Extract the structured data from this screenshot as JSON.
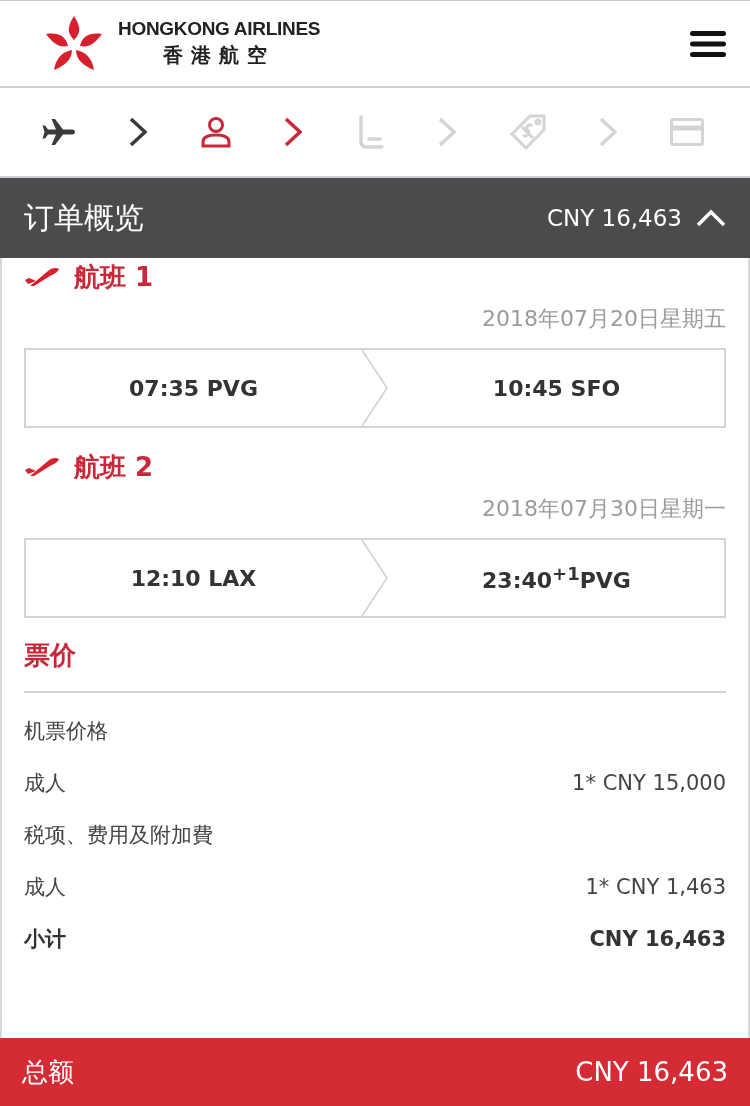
{
  "header": {
    "brand_en": "HONGKONG AIRLINES",
    "brand_zh": "香港航空"
  },
  "steps": [
    {
      "kind": "flight",
      "completed": true,
      "selected": false
    },
    {
      "kind": "passenger",
      "completed": false,
      "selected": true
    },
    {
      "kind": "seat",
      "completed": false,
      "selected": false
    },
    {
      "kind": "extras",
      "completed": false,
      "selected": false
    },
    {
      "kind": "payment",
      "completed": false,
      "selected": false
    }
  ],
  "summary": {
    "title": "订单概览",
    "amount": "CNY 16,463",
    "expanded": true
  },
  "flights": [
    {
      "title": "航班 1",
      "date": "2018年07月20日星期五",
      "depart": "07:35 PVG",
      "arrive": "10:45 SFO"
    },
    {
      "title": "航班 2",
      "date": "2018年07月30日星期一",
      "depart": "12:10 LAX",
      "arrive": "23:40$^{+1}$PVG"
    }
  ],
  "fare": {
    "title": "票价",
    "lines": [
      {
        "kind": "heading",
        "label": "机票价格"
      },
      {
        "kind": "item",
        "label": "成人",
        "amount": "1* CNY 15,000"
      },
      {
        "kind": "heading",
        "label": "税项、费用及附加費"
      },
      {
        "kind": "item",
        "label": "成人",
        "amount": "1* CNY 1,463"
      },
      {
        "kind": "subtotal",
        "label": "小计",
        "amount": "CNY 16,463"
      }
    ]
  },
  "total": {
    "label": "总额",
    "amount": "CNY 16,463"
  }
}
